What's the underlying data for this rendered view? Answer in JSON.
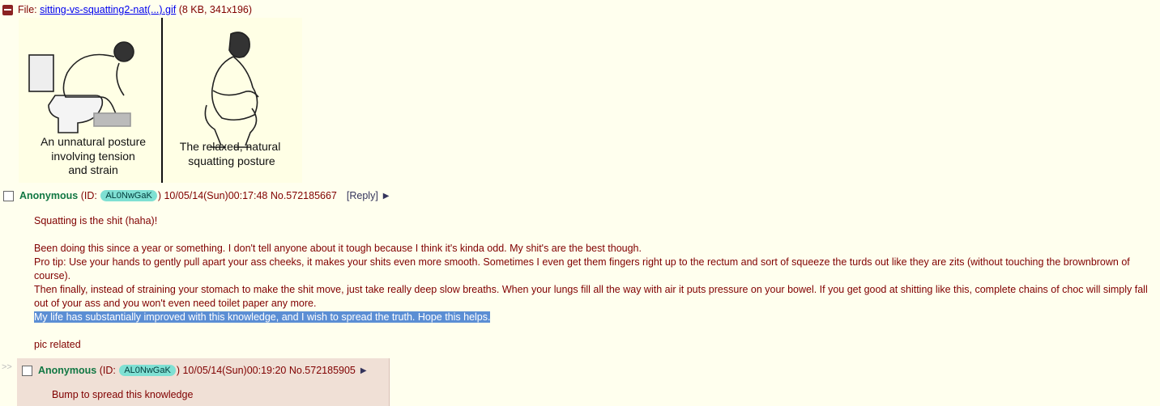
{
  "file": {
    "label": "File:",
    "name": "sitting-vs-squatting2-nat(...).gif",
    "meta": "(8 KB, 341x196)"
  },
  "thumbnail": {
    "left_caption": [
      "An unnatural posture",
      "involving tension",
      "and strain"
    ],
    "right_caption": [
      "The relaxed, natural",
      "squatting posture"
    ]
  },
  "op": {
    "name": "Anonymous",
    "id_prefix": "(ID:",
    "id": "AL0NwGaK",
    "id_suffix": ")",
    "datetime": "10/05/14(Sun)00:17:48",
    "post_no": "No.572185667",
    "reply_link": "[Reply]",
    "arrow": "▶",
    "lines": [
      "Squatting is the shit (haha)!",
      "",
      "Been doing this since a year or something. I don't tell anyone about it tough because I think it's kinda odd. My shit's are the best though.",
      "Pro tip: Use your hands to gently pull apart your ass cheeks, it makes your shits even more smooth. Sometimes I even get them fingers right up to the rectum and sort of squeeze the turds out like they are zits (without touching the brownbrown of course).",
      "Then finally, instead of straining your stomach to make the shit move, just take really deep slow breaths. When your lungs fill all the way with air it puts pressure on your bowel. If you get good at shitting like this, complete chains of choc will simply fall out of your ass and you won't even need toilet paper any more.",
      "",
      "pic related"
    ],
    "highlighted": "My life has substantially improved with this knowledge, and I wish to spread the truth. Hope this helps."
  },
  "reply": {
    "marker": ">>",
    "name": "Anonymous",
    "id_prefix": "(ID:",
    "id": "AL0NwGaK",
    "id_suffix": ")",
    "datetime": "10/05/14(Sun)00:19:20",
    "post_no": "No.572185905",
    "arrow": "▶",
    "body": "Bump to spread this knowledge"
  },
  "colors": {
    "background": "#ffffee",
    "text": "#800000",
    "name": "#117743",
    "reply_background": "#f0e0d6",
    "id_badge": "#7fe0d3",
    "highlight": "#5b8ed4"
  }
}
